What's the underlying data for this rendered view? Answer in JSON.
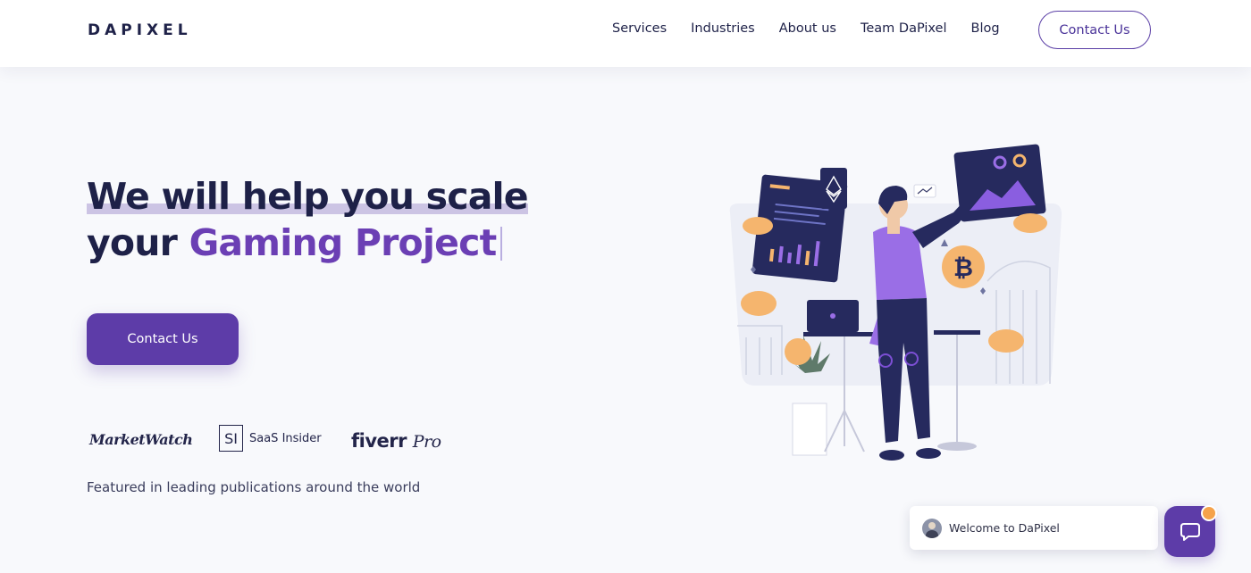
{
  "header": {
    "logo": "DAPIXEL",
    "nav": [
      "Services",
      "Industries",
      "About us",
      "Team DaPixel",
      "Blog"
    ],
    "contact_label": "Contact Us"
  },
  "hero": {
    "headline_line1": "We will help you scale",
    "headline_line2_prefix": "your ",
    "headline_line2_accent": "Gaming Project",
    "cta_label": "Contact Us"
  },
  "featured": {
    "brands": {
      "marketwatch": "MarketWatch",
      "saas_insider_mark": "SI",
      "saas_insider": "SaaS Insider",
      "fiverr": "fiverr",
      "fiverr_pro": "Pro"
    },
    "caption": "Featured in leading publications around the world"
  },
  "illustration": {
    "coin_symbol": "₿"
  },
  "chat": {
    "welcome": "Welcome to DaPixel"
  },
  "colors": {
    "brand_purple": "#5d3ca8",
    "accent_purple": "#6b3fb4",
    "navy": "#1e2148",
    "coin_orange": "#f5b56e"
  }
}
